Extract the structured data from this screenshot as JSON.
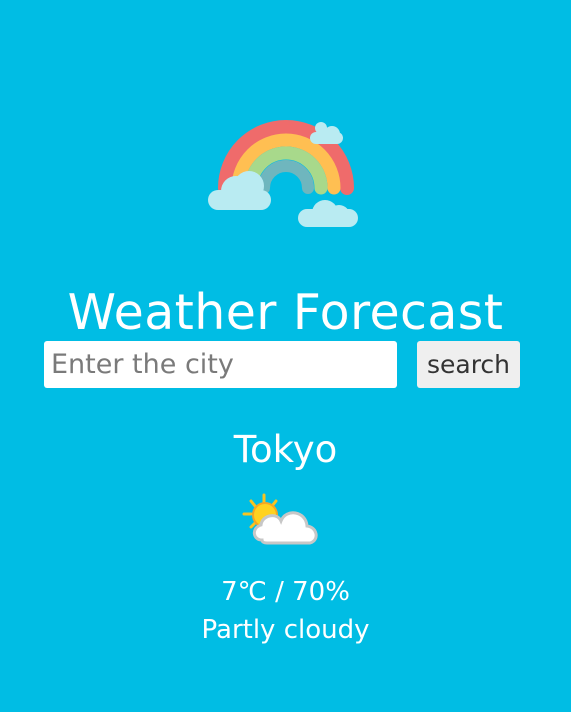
{
  "app": {
    "title": "Weather Forecast",
    "logo_icon": "rainbow-cloud-icon"
  },
  "search": {
    "placeholder": "Enter the city",
    "value": "",
    "button_label": "search"
  },
  "weather": {
    "city": "Tokyo",
    "icon": "partly-cloudy-icon",
    "temperature": "7℃",
    "separator": " / ",
    "humidity": "70%",
    "description": "Partly cloudy"
  },
  "colors": {
    "background": "#00bde4",
    "text": "#ffffff",
    "input": "#ffffff",
    "button": "#efefef"
  }
}
